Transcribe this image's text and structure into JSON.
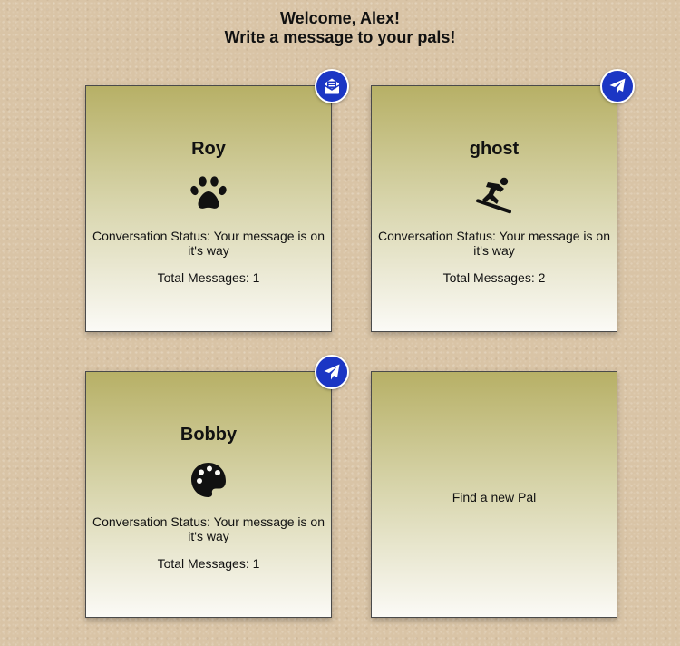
{
  "header": {
    "welcome": "Welcome, Alex!",
    "subtitle": "Write a message to your pals!"
  },
  "pals": [
    {
      "name": "Roy",
      "icon": "paw-icon",
      "status": "Conversation Status: Your message is on it's way",
      "total": "Total Messages: 1",
      "badge_icon": "envelope-open-icon"
    },
    {
      "name": "ghost",
      "icon": "snowboarding-icon",
      "status": "Conversation Status: Your message is on it's way",
      "total": "Total Messages: 2",
      "badge_icon": "paper-plane-icon"
    },
    {
      "name": "Bobby",
      "icon": "palette-icon",
      "status": "Conversation Status: Your message is on it's way",
      "total": "Total Messages: 1",
      "badge_icon": "paper-plane-icon"
    }
  ],
  "find_pal": {
    "label": "Find a new Pal"
  },
  "colors": {
    "badge": "#1b36c4",
    "card_top": "#b7b066",
    "card_bottom": "#fbfaf6"
  }
}
